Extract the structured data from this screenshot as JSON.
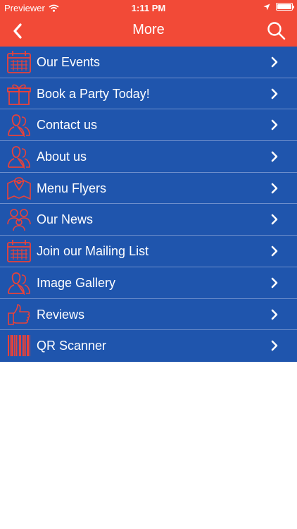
{
  "status": {
    "carrier": "Previewer",
    "time": "1:11 PM"
  },
  "navbar": {
    "title": "More"
  },
  "menu_items": [
    {
      "label": "Our Events",
      "icon": "calendar-icon"
    },
    {
      "label": "Book a Party Today!",
      "icon": "gift-icon"
    },
    {
      "label": "Contact us",
      "icon": "person-icon"
    },
    {
      "label": "About us",
      "icon": "person-icon"
    },
    {
      "label": "Menu Flyers",
      "icon": "map-pin-icon"
    },
    {
      "label": "Our News",
      "icon": "people-icon"
    },
    {
      "label": "Join our Mailing List",
      "icon": "calendar-icon"
    },
    {
      "label": "Image Gallery",
      "icon": "person-icon"
    },
    {
      "label": "Reviews",
      "icon": "thumbs-up-icon"
    },
    {
      "label": "QR Scanner",
      "icon": "barcode-icon"
    }
  ],
  "colors": {
    "header": "#f24a37",
    "menu_bg": "#1f55ad",
    "divider": "#6d8ecb",
    "icon_stroke": "#e8423a"
  }
}
